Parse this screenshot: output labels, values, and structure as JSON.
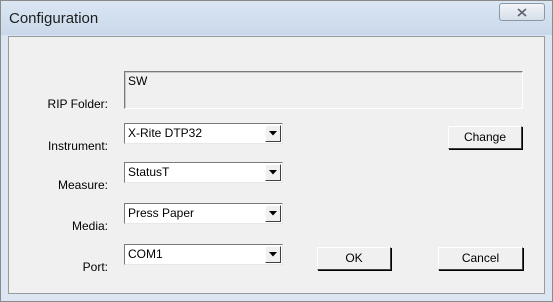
{
  "window": {
    "title": "Configuration"
  },
  "labels": {
    "rip_folder": "RIP Folder:",
    "instrument": "Instrument:",
    "measure": "Measure:",
    "media": "Media:",
    "port": "Port:"
  },
  "fields": {
    "rip_folder_value": "SW",
    "instrument_value": "X-Rite DTP32",
    "measure_value": "StatusT",
    "media_value": "Press Paper",
    "port_value": "COM1"
  },
  "buttons": {
    "change": "Change",
    "ok": "OK",
    "cancel": "Cancel"
  },
  "icons": {
    "close": "close-icon",
    "dropdown": "chevron-down-icon"
  },
  "colors": {
    "titlebar": "#c9d8ea",
    "client_bg": "#f0f0f0"
  }
}
